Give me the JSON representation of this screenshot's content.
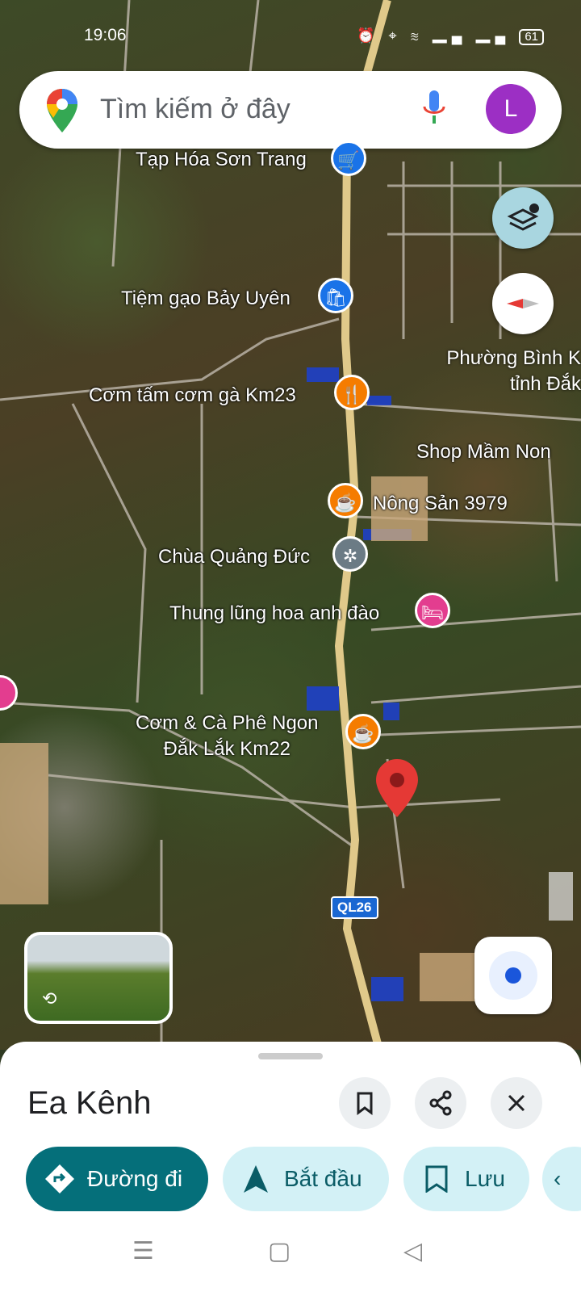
{
  "status": {
    "time": "19:06",
    "battery": "61"
  },
  "search": {
    "placeholder": "Tìm kiếm ở đây",
    "avatar_letter": "L"
  },
  "pois": {
    "p1": "Tạp Hóa Sơn Trang",
    "p2": "Tiệm gạo Bảy Uyên",
    "p3": "Cơm tấm cơm gà Km23",
    "p4": "Nông Sản 3979",
    "p5": "Chùa Quảng Đức",
    "p6": "Thung lũng hoa anh đào",
    "p7a": "Cơm & Cà Phê Ngon",
    "p7b": "Đắk Lắk Km22",
    "p8": "Shop Mầm Non"
  },
  "area": {
    "line1": "Phường Bình K",
    "line2": "tỉnh Đắk"
  },
  "road_shield": "QL26",
  "place": {
    "title": "Ea Kênh"
  },
  "actions": {
    "directions": "Đường đi",
    "start": "Bắt đầu",
    "save": "Lưu"
  },
  "colors": {
    "primary": "#056f7a",
    "chip_bg": "#d3f1f6",
    "pin_red": "#e53935",
    "road": "#d9c27a"
  }
}
